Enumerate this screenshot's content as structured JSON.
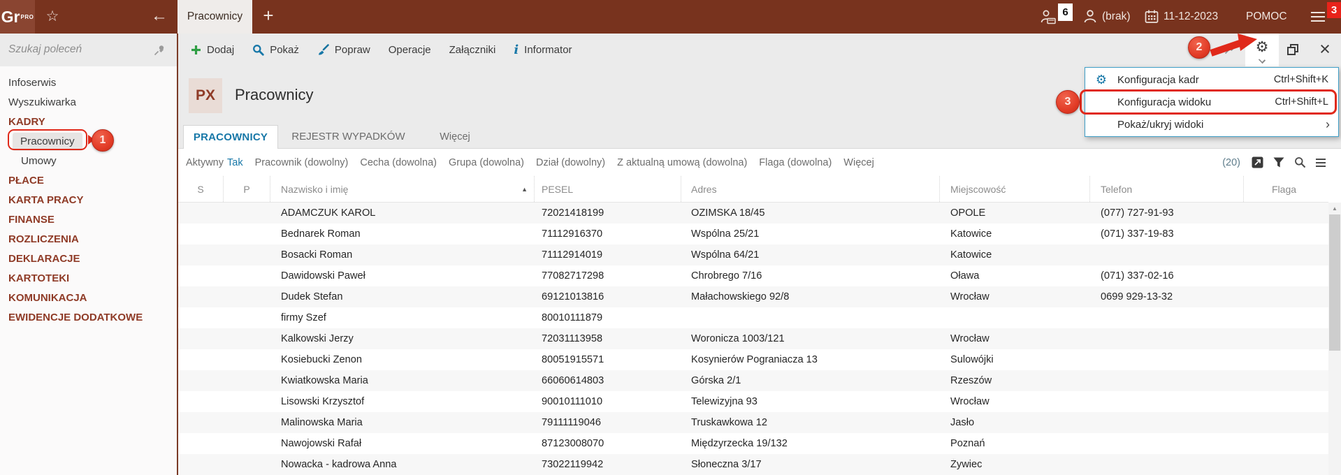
{
  "topbar": {
    "logo_text": "Gr",
    "logo_sup": "PRO",
    "active_tab": "Pracownicy",
    "sessions_badge": "6",
    "user_label": "(brak)",
    "date": "11-12-2023",
    "help_label": "POMOC",
    "notifications_badge": "3"
  },
  "toolbar": {
    "items": [
      {
        "label": "Dodaj",
        "icon": "plus-icon"
      },
      {
        "label": "Pokaż",
        "icon": "magnifier-icon"
      },
      {
        "label": "Popraw",
        "icon": "brush-icon"
      },
      {
        "label": "Operacje",
        "icon": ""
      },
      {
        "label": "Załączniki",
        "icon": ""
      },
      {
        "label": "Informator",
        "icon": "info-icon"
      }
    ]
  },
  "sidebar": {
    "search_placeholder": "Szukaj poleceń",
    "items": [
      {
        "label": "Infoserwis",
        "type": "link"
      },
      {
        "label": "Wyszukiwarka",
        "type": "link"
      },
      {
        "label": "KADRY",
        "type": "category"
      },
      {
        "label": "Pracownicy",
        "type": "subitem",
        "selected": true
      },
      {
        "label": "Umowy",
        "type": "subitem"
      },
      {
        "label": "PŁACE",
        "type": "category"
      },
      {
        "label": "KARTA PRACY",
        "type": "category"
      },
      {
        "label": "FINANSE",
        "type": "category"
      },
      {
        "label": "ROZLICZENIA",
        "type": "category"
      },
      {
        "label": "DEKLARACJE",
        "type": "category"
      },
      {
        "label": "KARTOTEKI",
        "type": "category"
      },
      {
        "label": "KOMUNIKACJA",
        "type": "category"
      },
      {
        "label": "EWIDENCJE DODATKOWE",
        "type": "category"
      }
    ]
  },
  "main": {
    "module_badge": "PX",
    "title": "Pracownicy",
    "tabs": [
      {
        "label": "PRACOWNICY",
        "active": true
      },
      {
        "label": "REJESTR WYPADKÓW",
        "active": false
      },
      {
        "label": "Więcej",
        "active": false
      }
    ],
    "filters": [
      {
        "label": "Aktywny",
        "value": "Tak"
      },
      {
        "label": "Pracownik (dowolny)",
        "value": ""
      },
      {
        "label": "Cecha (dowolna)",
        "value": ""
      },
      {
        "label": "Grupa (dowolna)",
        "value": ""
      },
      {
        "label": "Dział (dowolny)",
        "value": ""
      },
      {
        "label": "Z aktualną umową (dowolna)",
        "value": ""
      },
      {
        "label": "Flaga (dowolna)",
        "value": ""
      },
      {
        "label": "Więcej",
        "value": ""
      }
    ],
    "count": "(20)"
  },
  "table": {
    "columns": [
      "S",
      "P",
      "Nazwisko i imię",
      "PESEL",
      "Adres",
      "Miejscowość",
      "Telefon",
      "Flaga"
    ],
    "sort_column": "Nazwisko i imię",
    "sort_dir": "asc",
    "sort_glyph": "▲",
    "rows": [
      {
        "s": "",
        "p": "",
        "name": "ADAMCZUK KAROL",
        "pesel": "72021418199",
        "adres": "OZIMSKA 18/45",
        "city": "OPOLE",
        "phone": "(077) 727-91-93",
        "flag": ""
      },
      {
        "s": "",
        "p": "",
        "name": "Bednarek Roman",
        "pesel": "71112916370",
        "adres": "Wspólna 25/21",
        "city": "Katowice",
        "phone": "(071) 337-19-83",
        "flag": ""
      },
      {
        "s": "",
        "p": "",
        "name": "Bosacki Roman",
        "pesel": "71112914019",
        "adres": "Wspólna 64/21",
        "city": "Katowice",
        "phone": "",
        "flag": ""
      },
      {
        "s": "",
        "p": "",
        "name": "Dawidowski Paweł",
        "pesel": "77082717298",
        "adres": "Chrobrego 7/16",
        "city": "Oława",
        "phone": "(071) 337-02-16",
        "flag": ""
      },
      {
        "s": "",
        "p": "",
        "name": "Dudek Stefan",
        "pesel": "69121013816",
        "adres": "Małachowskiego 92/8",
        "city": "Wrocław",
        "phone": "0699 929-13-32",
        "flag": ""
      },
      {
        "s": "",
        "p": "",
        "name": "firmy Szef",
        "pesel": "80010111879",
        "adres": "",
        "city": "",
        "phone": "",
        "flag": ""
      },
      {
        "s": "",
        "p": "",
        "name": "Kalkowski Jerzy",
        "pesel": "72031113958",
        "adres": "Woronicza 1003/121",
        "city": "Wrocław",
        "phone": "",
        "flag": ""
      },
      {
        "s": "",
        "p": "",
        "name": "Kosiebucki Zenon",
        "pesel": "80051915571",
        "adres": "Kosynierów Pograniacza 13",
        "city": "Sulowójki",
        "phone": "",
        "flag": ""
      },
      {
        "s": "",
        "p": "",
        "name": "Kwiatkowska Maria",
        "pesel": "66060614803",
        "adres": "Górska 2/1",
        "city": "Rzeszów",
        "phone": "",
        "flag": ""
      },
      {
        "s": "",
        "p": "",
        "name": "Lisowski Krzysztof",
        "pesel": "90010111010",
        "adres": "Telewizyjna 93",
        "city": "Wrocław",
        "phone": "",
        "flag": ""
      },
      {
        "s": "",
        "p": "",
        "name": "Malinowska Maria",
        "pesel": "79111119046",
        "adres": "Truskawkowa 12",
        "city": "Jasło",
        "phone": "",
        "flag": ""
      },
      {
        "s": "",
        "p": "",
        "name": "Nawojowski Rafał",
        "pesel": "87123008070",
        "adres": "Międzyrzecka 19/132",
        "city": "Poznań",
        "phone": "",
        "flag": ""
      },
      {
        "s": "",
        "p": "",
        "name": "Nowacka - kadrowa Anna",
        "pesel": "73022119942",
        "adres": "Słoneczna 3/17",
        "city": "Żywiec",
        "phone": "",
        "flag": ""
      }
    ]
  },
  "menu": {
    "items": [
      {
        "label": "Konfiguracja kadr",
        "shortcut": "Ctrl+Shift+K",
        "icon": "gear-icon"
      },
      {
        "label": "Konfiguracja widoku",
        "shortcut": "Ctrl+Shift+L",
        "icon": ""
      },
      {
        "label": "Pokaż/ukryj widoki",
        "shortcut": "",
        "submenu": "›"
      }
    ]
  },
  "annotations": {
    "step1": "1",
    "step2": "2",
    "step3": "3"
  },
  "colors": {
    "maroon": "#78331e",
    "maroon_logo": "#8a4531",
    "accent_blue": "#1878a8",
    "annotation_red": "#e0291a",
    "green_add": "#2f9e44",
    "panel_gray": "#ebebeb"
  }
}
